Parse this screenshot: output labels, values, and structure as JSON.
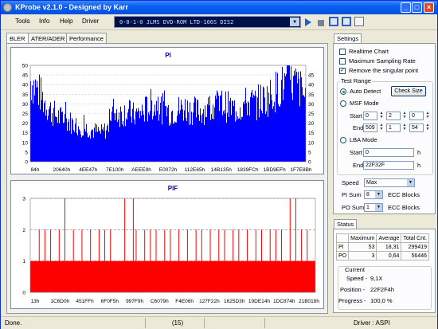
{
  "window": {
    "title": "KProbe v2.1.0 - Designed by Karr"
  },
  "menu": [
    "Tools",
    "Info",
    "Help",
    "Driver"
  ],
  "drive": {
    "label": "0-0-1-0   JLMS  DVD-ROM LTD-166S DIS2"
  },
  "tabs": [
    "BLER",
    "ATER/ADER",
    "Performance"
  ],
  "pi_chart": {
    "title": "PI",
    "ylim": [
      0,
      50
    ],
    "y_ticks_left": [
      "0",
      "5",
      "10",
      "15",
      "20",
      "25",
      "30",
      "35",
      "40",
      "45",
      "50"
    ],
    "y_ticks_right": [
      "0",
      "5",
      "10",
      "15",
      "20",
      "25",
      "30",
      "35",
      "40",
      "45"
    ],
    "x_ticks": [
      "84h",
      "20640h",
      "4EE47h",
      "7E100h",
      "AEEE9h",
      "E0072h",
      "112E65h",
      "14B135h",
      "1839FCh",
      "1BD9EFh",
      "1F7E8Bh"
    ]
  },
  "pif_chart": {
    "title": "PIF",
    "ylim": [
      0,
      3
    ],
    "y_ticks": [
      "0",
      "1",
      "2",
      "3"
    ],
    "x_ticks": [
      "13h",
      "1C6D0h",
      "451FFh",
      "6F0F5h",
      "997F9h",
      "C6079h",
      "F4E06h",
      "127F22h",
      "1625D3h",
      "19DE14h",
      "1DC874h",
      "21B018h"
    ]
  },
  "chart_data": [
    {
      "type": "bar",
      "title": "PI",
      "ylim": [
        0,
        50
      ],
      "x_range": [
        "84h",
        "22F32Fh"
      ],
      "profile": [
        42,
        38,
        32,
        27,
        24,
        22,
        21,
        19,
        18,
        17,
        16,
        15,
        17,
        27,
        25,
        26,
        24,
        25,
        27,
        30,
        28,
        27,
        26,
        27,
        28,
        27,
        26,
        27,
        28,
        29,
        30,
        28,
        27,
        29,
        31,
        30,
        32,
        33,
        36,
        39,
        40,
        41,
        38,
        33
      ]
    },
    {
      "type": "bar",
      "title": "PIF",
      "ylim": [
        0,
        3
      ],
      "x_range": [
        "13h",
        "22F32Fh"
      ],
      "baseline": 1,
      "spike_positions_pct": [
        3,
        5,
        7,
        10,
        12,
        15,
        18,
        21,
        24,
        26,
        28,
        33,
        36,
        37,
        40,
        42,
        44,
        47,
        49,
        52,
        55,
        58,
        60,
        63,
        66,
        68,
        71,
        73,
        76,
        79,
        81,
        84,
        86,
        88,
        91,
        93,
        95,
        97
      ],
      "spike_levels": [
        2,
        2,
        2,
        2,
        3,
        2,
        2,
        2,
        2,
        2,
        2,
        3,
        3,
        2,
        2,
        2,
        2,
        2,
        2,
        2,
        2,
        2,
        2,
        2,
        2,
        2,
        2,
        2,
        2,
        2,
        2,
        2,
        2,
        2,
        3,
        3,
        2,
        2
      ]
    }
  ],
  "settings": {
    "tab": "Settings",
    "realtime": "Realtime Chart",
    "max_sampling": "Maximum Sampling Rate",
    "remove_singular": "Remove the singular point",
    "test_range": "Test Range",
    "auto_detect": "Auto Detect",
    "check_size": "Check Size",
    "msf_mode": "MSF Mode",
    "start": "Start",
    "end": "End",
    "msf_start": [
      "0",
      "2",
      "0"
    ],
    "msf_end": [
      "509",
      "1",
      "54"
    ],
    "lba_mode": "LBA Mode",
    "lba_start": "0",
    "lba_end": "22F32F",
    "h": "h",
    "speed_label": "Speed",
    "speed_value": "Max",
    "pi_sum_label": "PI Sum",
    "pi_sum_value": "8",
    "po_sum_label": "PO Sum",
    "po_sum_value": "1",
    "ecc_blocks": "ECC Blocks"
  },
  "status": {
    "tab": "Status",
    "headers": [
      "",
      "Maximum",
      "Average",
      "Total Cnt."
    ],
    "rows": [
      [
        "PI",
        "53",
        "18,31",
        "299419"
      ],
      [
        "PO",
        "3",
        "0,64",
        "56446"
      ]
    ],
    "current": "Current",
    "speed_label": "Speed -",
    "speed_value": "9,1X",
    "position_label": "Position -",
    "position_value": "22F2F4h",
    "progress_label": "Progress -",
    "progress_value": "100,0 %"
  },
  "statusbar": {
    "left": "Done.",
    "center": "(15)",
    "right": "Driver : ASPI"
  },
  "colors": {
    "bar": "#0000ff",
    "pif": "#ff0000",
    "title": "#0000c0"
  }
}
